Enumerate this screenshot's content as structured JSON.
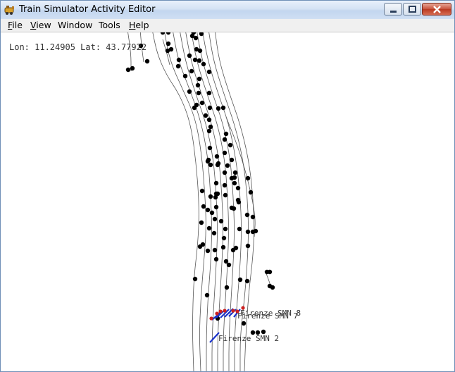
{
  "window": {
    "title": "Train Simulator Activity Editor",
    "accent": "#6f8fb7",
    "buttons": {
      "minimize": "minimize-icon",
      "maximize": "maximize-icon",
      "close": "close-icon"
    }
  },
  "menu": {
    "items": [
      {
        "label": "File",
        "accel": "F",
        "rest": "ile"
      },
      {
        "label": "View",
        "accel": "V",
        "rest": "iew"
      },
      {
        "label": "Window",
        "accel": "",
        "rest": "Window"
      },
      {
        "label": "Tools",
        "accel": "",
        "rest": "Tools"
      },
      {
        "label": "Help",
        "accel": "H",
        "rest": "elp"
      }
    ]
  },
  "map": {
    "coordinates": "Lon: 11.24905 Lat: 43.77922",
    "colors": {
      "track": "#555555",
      "node": "#000000",
      "platform": "#1a33cc",
      "signal": "#cc2020"
    },
    "labels": [
      {
        "text": "Firenze SMN 8"
      },
      {
        "text": "Firenze SMN 7"
      },
      {
        "text": "Firenze SMN 2"
      }
    ]
  }
}
